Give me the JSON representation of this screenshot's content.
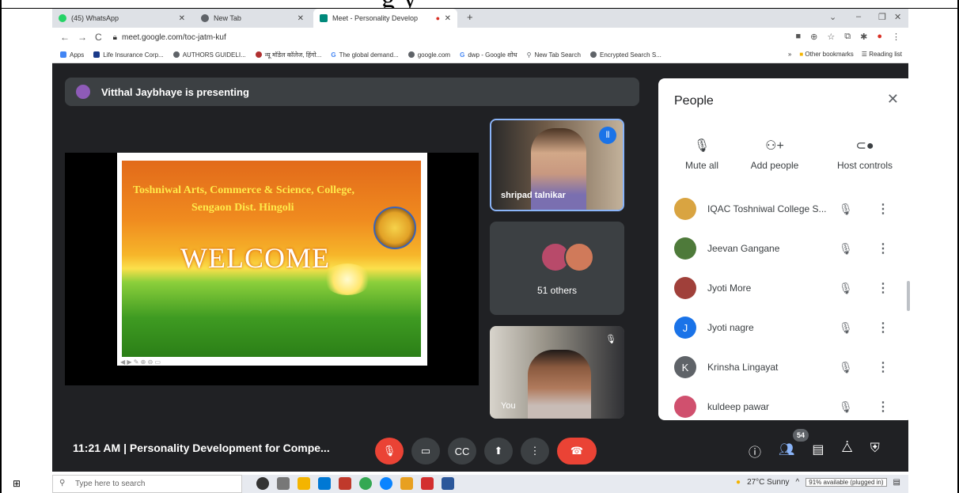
{
  "doc": {
    "heading_fragment": "g                y"
  },
  "browser": {
    "tabs": [
      {
        "label": "(45) WhatsApp",
        "color": "#25d366"
      },
      {
        "label": "New Tab",
        "color": "#5f6368"
      },
      {
        "label": "Meet - Personality Develop",
        "color": "#00897b"
      }
    ],
    "url": "meet.google.com/toc-jatm-kuf",
    "bookmarks": [
      {
        "label": "Apps",
        "color": "#4285f4"
      },
      {
        "label": "Life Insurance Corp...",
        "color": "#1a3a8a"
      },
      {
        "label": "AUTHORS GUIDELI...",
        "color": "#5f6368"
      },
      {
        "label": "न्यू मॉडेल कॉलेज, हिंगो...",
        "color": "#b03030"
      },
      {
        "label": "The global demand...",
        "color": "#4285f4"
      },
      {
        "label": "google.com",
        "color": "#5f6368"
      },
      {
        "label": "dwp - Google शोध",
        "color": "#4285f4"
      },
      {
        "label": "New Tab Search",
        "color": "#5f6368"
      },
      {
        "label": "Encrypted Search S...",
        "color": "#5f6368"
      }
    ],
    "other_bookmarks": "Other bookmarks",
    "reading_list": "Reading list"
  },
  "meet": {
    "presenting": "Vitthal Jaybhaye is presenting",
    "slide": {
      "line1": "Toshniwal Arts, Commerce & Science, College,",
      "line2": "Sengaon Dist. Hingoli",
      "welcome": "WELCOME"
    },
    "tiles": {
      "speaker_name": "shripad talnikar",
      "others_label": "51 others",
      "self_name": "You"
    },
    "people": {
      "title": "People",
      "actions": [
        {
          "label": "Mute all",
          "icon": "mic-off-icon"
        },
        {
          "label": "Add people",
          "icon": "add-person-icon"
        },
        {
          "label": "Host controls",
          "icon": "toggle-icon"
        }
      ],
      "list": [
        {
          "name": "IQAC Toshniwal College S...",
          "initial": "",
          "color": "#d9a441"
        },
        {
          "name": "Jeevan Gangane",
          "initial": "",
          "color": "#4e7a3a"
        },
        {
          "name": "Jyoti More",
          "initial": "",
          "color": "#a0403a"
        },
        {
          "name": "Jyoti nagre",
          "initial": "J",
          "color": "#1a73e8"
        },
        {
          "name": "Krinsha Lingayat",
          "initial": "K",
          "color": "#5f6368"
        },
        {
          "name": "kuldeep pawar",
          "initial": "",
          "color": "#d0506e"
        }
      ]
    },
    "bottom": {
      "time_title": "11:21 AM  |  Personality Development for Compe...",
      "people_count": "54"
    }
  },
  "taskbar": {
    "search_placeholder": "Type here to search",
    "weather": "27°C  Sunny",
    "battery": "91% available (plugged in)"
  }
}
